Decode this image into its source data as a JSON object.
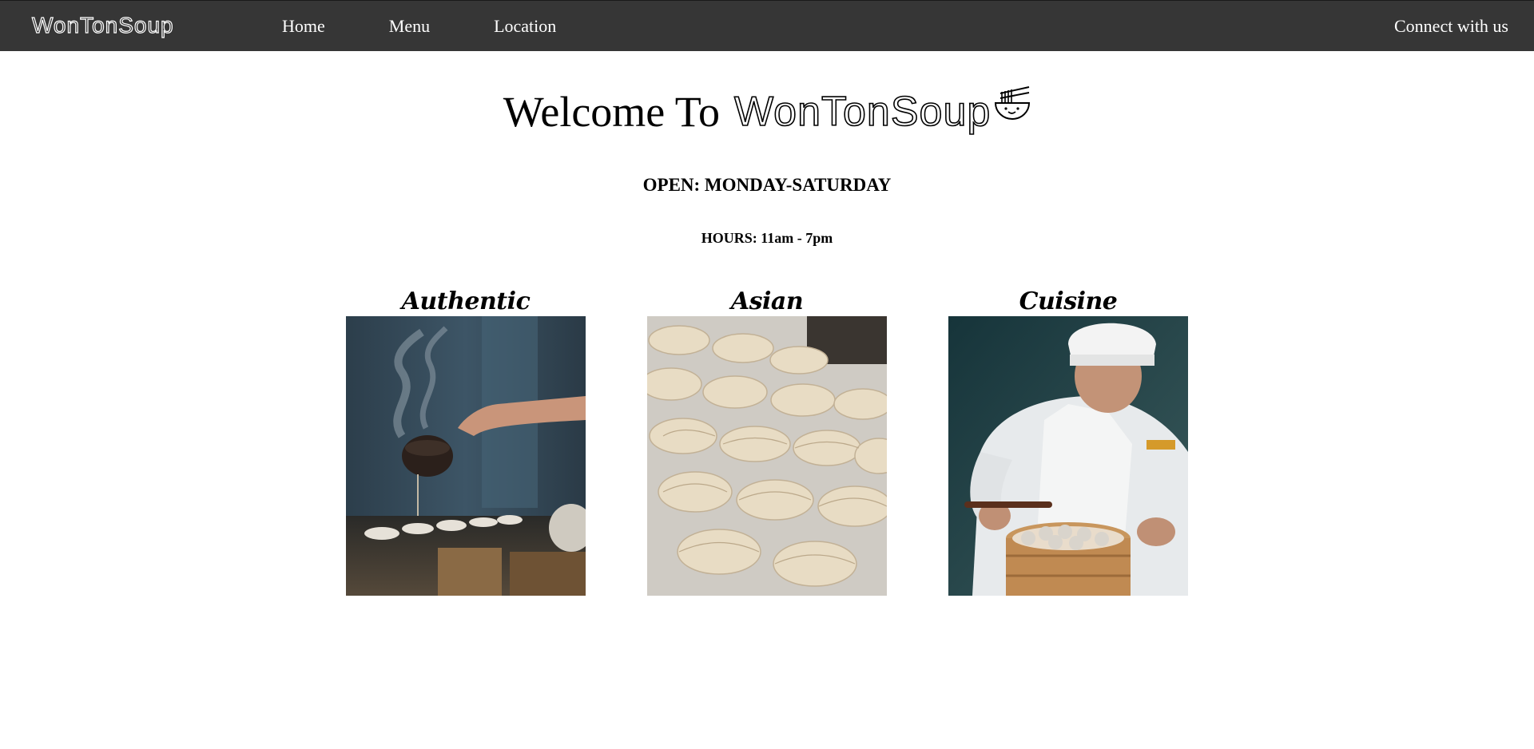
{
  "nav": {
    "brand": "WonTonSoup",
    "links": [
      "Home",
      "Menu",
      "Location"
    ],
    "connect": "Connect with us"
  },
  "hero": {
    "welcome_prefix": "Welcome To",
    "brand": "WonTonSoup",
    "open": "OPEN: MONDAY-SATURDAY",
    "hours": "HOURS: 11am - 7pm"
  },
  "cards": [
    {
      "title": "Authentic",
      "image": "tea-pouring-photo"
    },
    {
      "title": "Asian",
      "image": "dumplings-photo"
    },
    {
      "title": "Cuisine",
      "image": "chef-steamer-photo"
    }
  ],
  "colors": {
    "navbar_bg": "#363636",
    "nav_text": "#ffffff",
    "page_bg": "#ffffff",
    "text": "#000000"
  }
}
